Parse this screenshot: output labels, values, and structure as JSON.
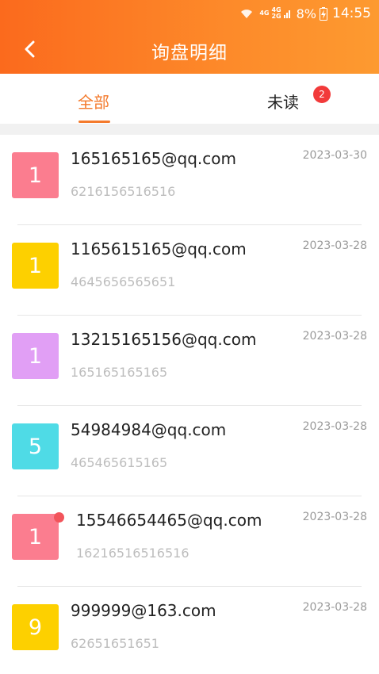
{
  "status_bar": {
    "net_top": "4G",
    "net_top2": "4G",
    "net_bottom": "2G",
    "battery": "8%",
    "time": "14:55"
  },
  "header": {
    "title": "询盘明细",
    "back_icon": "chevron-left-icon"
  },
  "tabs": {
    "all": "全部",
    "unread": "未读",
    "unread_count": "2",
    "active": "all"
  },
  "colors": {
    "header_start": "#fb6a1d",
    "header_end": "#fd9a30",
    "accent": "#f47a2c",
    "badge": "#f23a3a"
  },
  "items": [
    {
      "avatar": "1",
      "color": "#fb7d8f",
      "email": "165165165@qq.com",
      "number": "6216156516516",
      "date": "2023-03-30",
      "unread": false
    },
    {
      "avatar": "1",
      "color": "#fdd000",
      "email": "1165615165@qq.com",
      "number": "4645656565651",
      "date": "2023-03-28",
      "unread": false
    },
    {
      "avatar": "1",
      "color": "#e19ff5",
      "email": "13215165156@qq.com",
      "number": "165165165165",
      "date": "2023-03-28",
      "unread": false
    },
    {
      "avatar": "5",
      "color": "#4fdbe6",
      "email": "54984984@qq.com",
      "number": "465465615165",
      "date": "2023-03-28",
      "unread": false
    },
    {
      "avatar": "1",
      "color": "#fb7d8f",
      "email": "15546654465@qq.com",
      "number": "16216516516516",
      "date": "2023-03-28",
      "unread": true
    },
    {
      "avatar": "9",
      "color": "#fdd000",
      "email": "999999@163.com",
      "number": "62651651651",
      "date": "2023-03-28",
      "unread": false
    }
  ]
}
